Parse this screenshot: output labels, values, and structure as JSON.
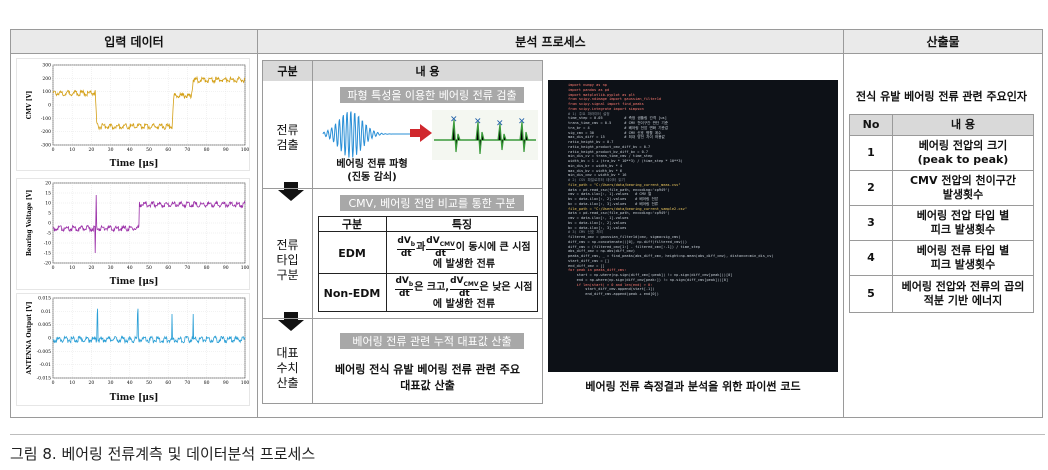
{
  "headers": {
    "input": "입력 데이터",
    "process": "분석 프로세스",
    "output": "산출물"
  },
  "charts": [
    {
      "ylabel": "CMV [V]",
      "xlabel": "Time [μs]",
      "yticks": [
        "300",
        "200",
        "100",
        "0",
        "-100",
        "-200",
        "-300"
      ],
      "xticks": [
        "0",
        "10",
        "20",
        "30",
        "40",
        "50",
        "60",
        "70",
        "80",
        "90",
        "100"
      ],
      "color": "#d4a017"
    },
    {
      "ylabel": "Bearing Voltage [V]",
      "xlabel": "Time [μs]",
      "yticks": [
        "20",
        "15",
        "10",
        "5",
        "0",
        "-5",
        "-10",
        "-15",
        "-20"
      ],
      "xticks": [
        "0",
        "10",
        "20",
        "30",
        "40",
        "50",
        "60",
        "70",
        "80",
        "90",
        "100"
      ],
      "color": "#9b30a8"
    },
    {
      "ylabel": "ANTENNA Output [V]",
      "xlabel": "Time [μs]",
      "yticks": [
        "0.015",
        "0.01",
        "0.005",
        "0",
        "-0.005",
        "-0.01",
        "-0.015"
      ],
      "xticks": [
        "0",
        "10",
        "20",
        "30",
        "40",
        "50",
        "60",
        "70",
        "80",
        "90",
        "100"
      ],
      "color": "#2a9fd6"
    }
  ],
  "process_table": {
    "col1": "구분",
    "col2": "내 용",
    "row1": {
      "label": "전류\n검출",
      "bar": "파형 특성을 이용한 베어링 전류 검출",
      "caption_line1": "베어링 전류 파형",
      "caption_line2": "(진동 감쇠)"
    },
    "row2": {
      "label": "전류\n타입\n구분",
      "bar": "CMV, 베어링 전압 비교를 통한 구분",
      "sub_col1": "구분",
      "sub_col2": "특징",
      "edm_label": "EDM",
      "edm_desc_a": "과",
      "edm_desc_b": "이 동시에 큰 시점",
      "edm_desc_c": "에 발생한 전류",
      "nonedm_label": "Non-EDM",
      "nonedm_desc_a": "은 크고,",
      "nonedm_desc_b": "은 낮은 시점",
      "nonedm_desc_c": "에 발생한 전류",
      "frac_num_b": "dV",
      "frac_sub_b": "b",
      "frac_num_cmv": "dV",
      "frac_sub_cmv": "CMV",
      "frac_den": "dt"
    },
    "row3": {
      "label": "대표\n수치\n산출",
      "bar": "베어링 전류 관련 누적 대표값 산출",
      "text": "베어링 전식 유발 베어링 전류 관련 주요\n대표값 산출"
    }
  },
  "code_caption": "베어링 전류 측정결과 분석을 위한 파이썬 코드",
  "code_lines": [
    "import numpy as np",
    "import pandas as pd",
    "import matplotlib.pyplot as plt",
    "from scipy.ndimage import gaussian_filter1d",
    "from scipy.signal import find_peaks",
    "from scipy.integrate import simpson",
    "",
    "# 1) 주요 파라미터 설정",
    "time_step = 0.05          # 측정 샘플링 간격 [us]",
    "trans_time_cmv = 0.5      # CMV 천이구간 판단 기준",
    "tra_br = 4                # 베어링 전압 변화 기준값",
    "",
    "sig_cmv = 30              # CMV 신호 평활 계수",
    "max_dis_diff = 15         # 최대 방전 차이 허용값",
    "",
    "ratio_height_bv = 0.7",
    "ratio_height_product_cmv_diff_bv = 0.7",
    "ratio_height_product_bv_diff_bv = 0.7",
    "",
    "min_dis_cv = trans_time_cmv / time_step",
    "width_bv = 1 + (tra_bv * 10**3) / (time_step * 10**3)",
    "min_dis_br = width_bv * 4",
    "max_dis_bv = width_bv * 6",
    "min_dis_cmv = width_bv * 16",
    "",
    "# 2) CSV 파일로부터 데이터 읽기",
    "",
    "file_path = \"C:/Users/data/bearing_current_meas.csv\"",
    "data = pd.read_csv(file_path, encoding='cp949')",
    "",
    "cmv = data.iloc[:, 1].values   # CMV 열",
    "bv = data.iloc[:, 2].values    # 베어링 전압",
    "bc = data.iloc[:, 3].values    # 베어링 전류",
    "",
    "",
    "file_path = \"C:/Users/data/bearing_current_sample2.csv\"",
    "data = pd.read_csv(file_path, encoding='cp949')",
    "",
    "cmv = data.iloc[:, 1].values",
    "bv = data.iloc[:, 2].values",
    "bc = data.iloc[:, 3].values",
    "",
    "# 3) CMV 신호 처리",
    "filtered_cmv = gaussian_filter1d(cmv, sigma=sig_cmv)",
    "diff_cmv = np.concatenate(([0], np.diff(filtered_cmv)))",
    "diff_cmv = (filtered_cmv[1:] - filtered_cmv[:-1]) / time_step",
    "abs_diff_cmv = np.abs(diff_cmv)",
    "",
    "peaks_diff_cmv, _ = find_peaks(abs_diff_cmv, height=np.mean(abs_diff_cmv), distance=min_dis_cv)",
    "",
    "start_diff_cmv = []",
    "end_diff_cmv = []",
    "for peak in peaks_diff_cmv:",
    "    start = np.where(np.sign(diff_cmv[:peak]) != np.sign(diff_cmv[peak]))[0]",
    "    end = np.where(np.sign(diff_cmv[peak:]) != np.sign(diff_cmv[peak]))[0]",
    "    if len(start) > 0 and len(end) > 0:",
    "        start_diff_cmv.append(start[-1])",
    "        end_diff_cmv.append(peak + end[0])"
  ],
  "output_table": {
    "title": "전식 유발 베어링 전류 관련 주요인자",
    "col1": "No",
    "col2": "내 용",
    "rows": [
      {
        "no": "1",
        "text": "베어링 전압의 크기\n(peak to peak)"
      },
      {
        "no": "2",
        "text": "CMV 전압의 천이구간\n발생횟수"
      },
      {
        "no": "3",
        "text": "베어링 전압 타입 별\n피크 발생횟수"
      },
      {
        "no": "4",
        "text": "베어링 전류 타입 별\n피크 발생횟수"
      },
      {
        "no": "5",
        "text": "베어링 전압와 전류의 곱의\n적분 기반 에너지"
      }
    ]
  },
  "caption": "그림 8. 베어링 전류계측 및 데이터분석 프로세스"
}
